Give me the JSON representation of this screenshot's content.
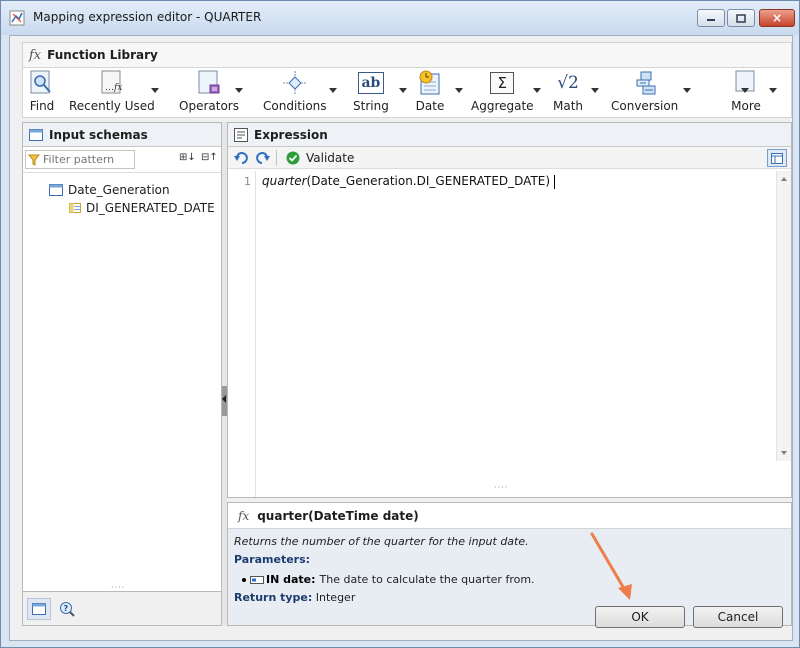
{
  "window": {
    "title": "Mapping expression editor - QUARTER",
    "close_label": "×"
  },
  "function_library": {
    "label": "Function Library",
    "fx_symbol": "fx",
    "items": [
      {
        "label": "Find",
        "icon": "magnifier-icon",
        "has_dropdown": false
      },
      {
        "label": "Recently Used",
        "icon": "recent-fx-icon",
        "has_dropdown": true
      },
      {
        "label": "Operators",
        "icon": "operators-icon",
        "has_dropdown": true
      },
      {
        "label": "Conditions",
        "icon": "conditions-icon",
        "has_dropdown": true
      },
      {
        "label": "String",
        "icon": "string-ab-icon",
        "has_dropdown": true
      },
      {
        "label": "Date",
        "icon": "date-clock-icon",
        "has_dropdown": true
      },
      {
        "label": "Aggregate",
        "icon": "sigma-icon",
        "has_dropdown": true
      },
      {
        "label": "Math",
        "icon": "sqrt-icon",
        "has_dropdown": true
      },
      {
        "label": "Conversion",
        "icon": "conversion-icon",
        "has_dropdown": true
      },
      {
        "label": "More",
        "icon": "more-icon",
        "has_dropdown": true
      }
    ],
    "icon_glyphs": {
      "string": "ab",
      "aggregate": "Σ",
      "math": "√2"
    }
  },
  "input_schemas": {
    "label": "Input schemas",
    "filter_placeholder": "Filter pattern",
    "tree": [
      {
        "label": "Date_Generation",
        "level": 0
      },
      {
        "label": "DI_GENERATED_DATE",
        "level": 1
      }
    ]
  },
  "expression": {
    "label": "Expression",
    "validate_label": "Validate",
    "line_number": "1",
    "code_fn": "quarter",
    "code_args": "(Date_Generation.DI_GENERATED_DATE)"
  },
  "help": {
    "signature": "quarter(DateTime date)",
    "description": "Returns the number of the quarter for the input date.",
    "parameters_label": "Parameters:",
    "param_name": "IN date:",
    "param_desc": "The date to calculate the quarter from.",
    "return_label": "Return type:",
    "return_value": "Integer"
  },
  "buttons": {
    "ok": "OK",
    "cancel": "Cancel"
  },
  "colors": {
    "accent_arrow": "#ed7d4a",
    "validate_green": "#2e9e3a",
    "help_key": "#1c3d6e"
  }
}
